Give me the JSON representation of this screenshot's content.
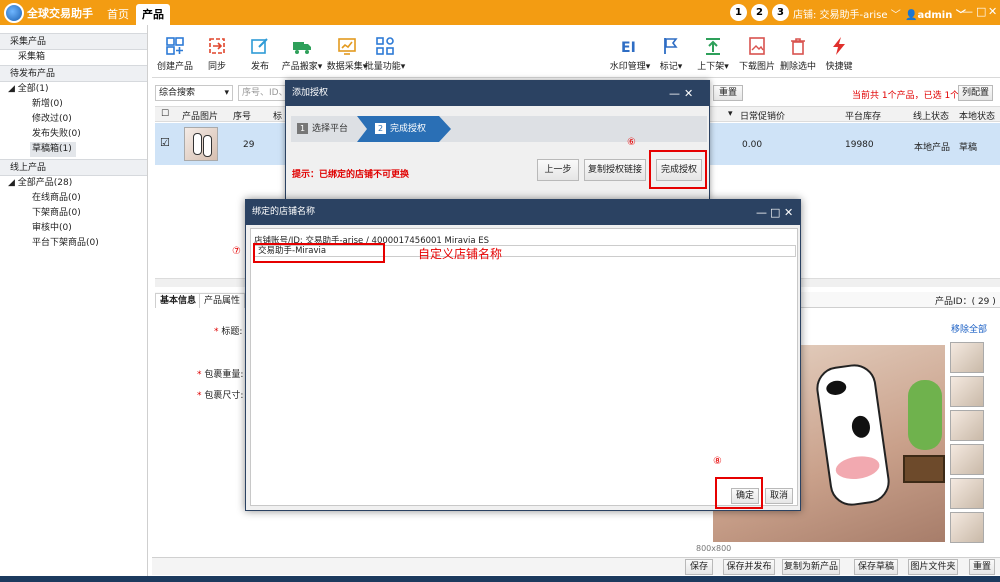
{
  "app": {
    "logo_text": "全球交易助手",
    "tabs": [
      "首页",
      "产品"
    ],
    "step_numbers": [
      "1",
      "2",
      "3"
    ],
    "store_label": "店铺: 交易助手-arise",
    "admin_label": "admin"
  },
  "sidebar": {
    "sections": [
      {
        "header": "采集产品",
        "items": [
          "采集箱"
        ]
      },
      {
        "header": "待发布产品",
        "items": [
          "全部(1)",
          "新增(0)",
          "修改过(0)",
          "发布失败(0)",
          "草稿箱(1)"
        ]
      },
      {
        "header": "线上产品",
        "items": [
          "全部产品(28)",
          "在线商品(0)",
          "下架商品(0)",
          "审核中(0)",
          "平台下架商品(0)"
        ]
      }
    ]
  },
  "toolbar": {
    "left": [
      "创建产品",
      "同步",
      "发布",
      "产品搬家",
      "数据采集",
      "批量功能"
    ],
    "right": [
      "水印管理",
      "标记",
      "上下架",
      "下载图片",
      "删除选中",
      "快捷键"
    ]
  },
  "search": {
    "mode": "综合搜索",
    "placeholder": "序号、ID、",
    "reset": "重置",
    "summary": "当前共 1个产品，已选 1个",
    "column_config": "列配置"
  },
  "table": {
    "headers": [
      "产品图片",
      "序号",
      "标",
      "日常促销价",
      "平台库存",
      "线上状态",
      "本地状态"
    ],
    "row": {
      "index": "29",
      "promo_price": "0.00",
      "stock": "19980",
      "online_status": "本地产品",
      "local_status": "草稿"
    }
  },
  "detail": {
    "tabs": [
      "基本信息",
      "产品属性"
    ],
    "product_id": "产品ID：( 29 )",
    "remove_all": "移除全部",
    "labels": [
      "标题:",
      "包裹重量:",
      "包裹尺寸:"
    ],
    "image_size": "800x800",
    "actions": [
      "保存",
      "保存并发布",
      "复制为新产品",
      "保存草稿",
      "图片文件夹",
      "重置"
    ]
  },
  "dialog_auth": {
    "title": "添加授权",
    "steps": [
      {
        "num": "1",
        "label": "选择平台"
      },
      {
        "num": "2",
        "label": "完成授权"
      }
    ],
    "hint": "提示：已绑定的店铺不可更换",
    "buttons": {
      "prev": "上一步",
      "copy": "复制授权链接",
      "finish": "完成授权"
    },
    "annotation": "⑥"
  },
  "dialog_bind": {
    "title": "绑定的店铺名称",
    "account_info": "店铺账号/ID: 交易助手-arise / 4000017456001 Miravia ES",
    "store_name_value": "交易助手-Miravia",
    "annotation_num": "⑦",
    "annotation_text": "自定义店铺名称",
    "confirm_annotation": "⑧",
    "buttons": {
      "ok": "确定",
      "cancel": "取消"
    }
  },
  "colors": {
    "orange": "#f39c12",
    "dialog_title": "#2b4262",
    "highlight": "#e60000"
  }
}
